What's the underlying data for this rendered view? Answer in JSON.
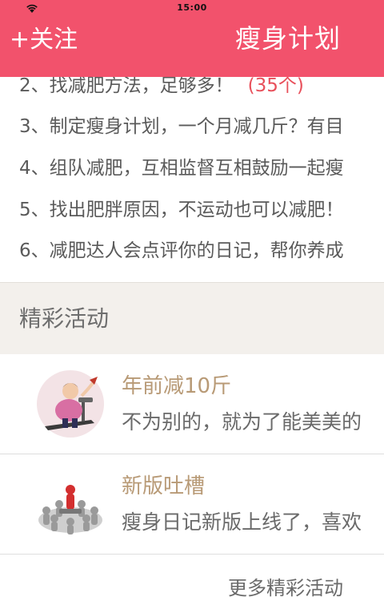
{
  "status_bar": {
    "time": "15:00"
  },
  "header": {
    "follow_label": "+关注",
    "title": "瘦身计划",
    "background": "#f2526c"
  },
  "plan_list": [
    {
      "text": "2、找减肥方法，足够多！",
      "count": "(35个)"
    },
    {
      "text": "3、制定瘦身计划，一个月减几斤？有目"
    },
    {
      "text": "4、组队减肥，互相监督互相鼓励一起瘦"
    },
    {
      "text": "5、找出肥胖原因，不运动也可以减肥！"
    },
    {
      "text": "6、减肥达人会点评你的日记，帮你养成"
    }
  ],
  "section": {
    "title": "精彩活动"
  },
  "activities": [
    {
      "title": "年前减10斤",
      "description": "不为别的，就为了能美美的",
      "icon": "treadmill-woman-icon"
    },
    {
      "title": "新版吐槽",
      "description": "瘦身日记新版上线了，喜欢",
      "icon": "group-meeting-icon"
    }
  ],
  "more_link": "更多精彩活动"
}
